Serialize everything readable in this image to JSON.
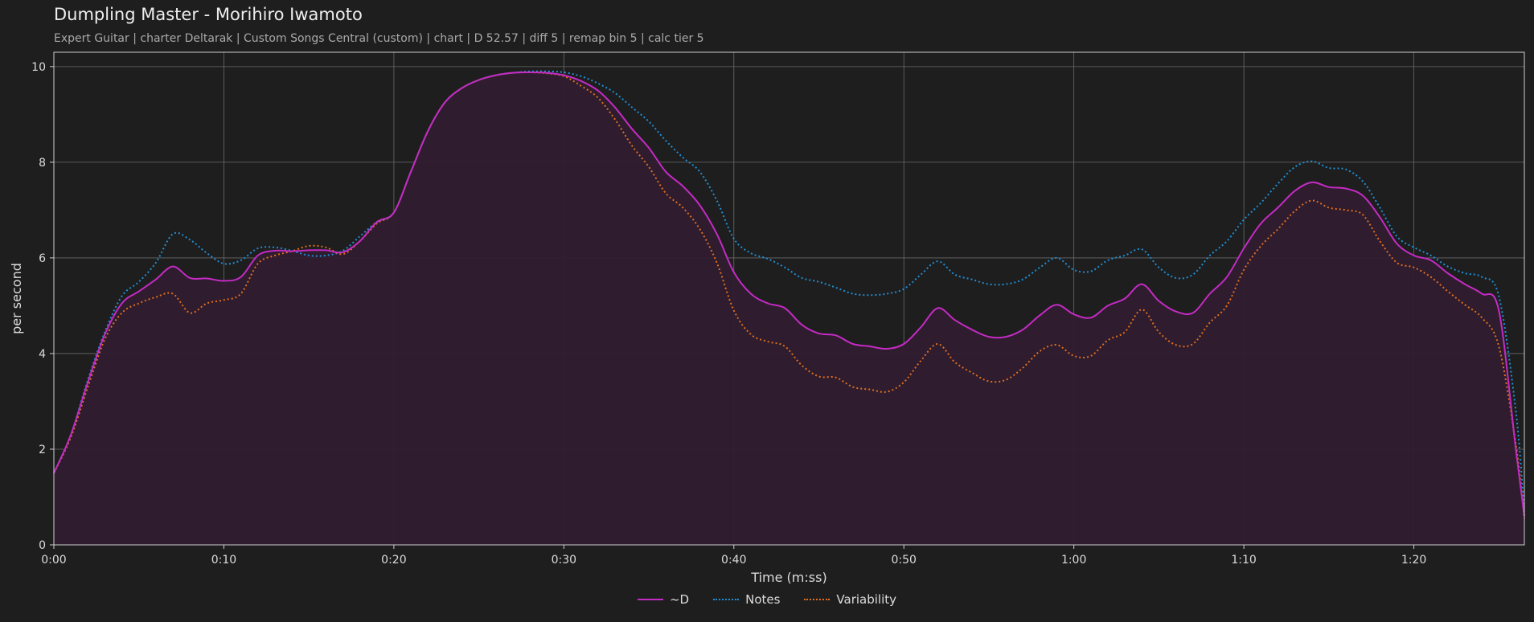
{
  "header": {
    "title": "Dumpling Master - Morihiro Iwamoto",
    "subtitle": "Expert Guitar  |  charter Deltarak  |  Custom Songs Central (custom)  |  chart  |  D 52.57  |  diff 5  |  remap bin 5  |  calc tier 5"
  },
  "colors": {
    "background": "#1e1e1e",
    "plot_border": "#cfcfcf",
    "grid": "#6a6a6a",
    "d_line": "#c42bc4",
    "d_fill": "#301c2f",
    "notes": "#1f8fd6",
    "variability": "#e0701e"
  },
  "chart_data": {
    "type": "line",
    "xlabel": "Time (m:ss)",
    "ylabel": "per second",
    "xlim": [
      0,
      86.5
    ],
    "ylim": [
      0,
      10.3
    ],
    "x_ticks": [
      {
        "value": 0,
        "label": "0:00"
      },
      {
        "value": 10,
        "label": "0:10"
      },
      {
        "value": 20,
        "label": "0:20"
      },
      {
        "value": 30,
        "label": "0:30"
      },
      {
        "value": 40,
        "label": "0:40"
      },
      {
        "value": 50,
        "label": "0:50"
      },
      {
        "value": 60,
        "label": "1:00"
      },
      {
        "value": 70,
        "label": "1:10"
      },
      {
        "value": 80,
        "label": "1:20"
      }
    ],
    "y_ticks": [
      0,
      2,
      4,
      6,
      8,
      10
    ],
    "grid": true,
    "legend_position": "bottom-center",
    "series": [
      {
        "name": "~D",
        "style": "solid",
        "filled": true,
        "color": "#c42bc4",
        "points": [
          [
            0,
            1.5
          ],
          [
            1,
            2.3
          ],
          [
            2,
            3.4
          ],
          [
            3,
            4.4
          ],
          [
            4,
            5.05
          ],
          [
            5,
            5.3
          ],
          [
            6,
            5.55
          ],
          [
            7,
            5.82
          ],
          [
            8,
            5.58
          ],
          [
            9,
            5.57
          ],
          [
            10,
            5.52
          ],
          [
            11,
            5.6
          ],
          [
            12,
            6.05
          ],
          [
            13,
            6.15
          ],
          [
            14,
            6.14
          ],
          [
            15,
            6.16
          ],
          [
            16,
            6.16
          ],
          [
            17,
            6.12
          ],
          [
            18,
            6.35
          ],
          [
            19,
            6.75
          ],
          [
            20,
            6.95
          ],
          [
            21,
            7.8
          ],
          [
            22,
            8.65
          ],
          [
            23,
            9.25
          ],
          [
            24,
            9.55
          ],
          [
            25,
            9.72
          ],
          [
            26,
            9.82
          ],
          [
            27,
            9.87
          ],
          [
            28,
            9.88
          ],
          [
            29,
            9.87
          ],
          [
            30,
            9.82
          ],
          [
            31,
            9.7
          ],
          [
            32,
            9.5
          ],
          [
            33,
            9.15
          ],
          [
            34,
            8.7
          ],
          [
            35,
            8.3
          ],
          [
            36,
            7.8
          ],
          [
            37,
            7.5
          ],
          [
            38,
            7.1
          ],
          [
            39,
            6.5
          ],
          [
            40,
            5.7
          ],
          [
            41,
            5.25
          ],
          [
            42,
            5.05
          ],
          [
            43,
            4.95
          ],
          [
            44,
            4.6
          ],
          [
            45,
            4.42
          ],
          [
            46,
            4.38
          ],
          [
            47,
            4.2
          ],
          [
            48,
            4.15
          ],
          [
            49,
            4.1
          ],
          [
            50,
            4.2
          ],
          [
            51,
            4.55
          ],
          [
            52,
            4.95
          ],
          [
            53,
            4.7
          ],
          [
            54,
            4.5
          ],
          [
            55,
            4.35
          ],
          [
            56,
            4.35
          ],
          [
            57,
            4.5
          ],
          [
            58,
            4.8
          ],
          [
            59,
            5.02
          ],
          [
            60,
            4.82
          ],
          [
            61,
            4.75
          ],
          [
            62,
            5.0
          ],
          [
            63,
            5.15
          ],
          [
            64,
            5.45
          ],
          [
            65,
            5.1
          ],
          [
            66,
            4.88
          ],
          [
            67,
            4.85
          ],
          [
            68,
            5.25
          ],
          [
            69,
            5.6
          ],
          [
            70,
            6.2
          ],
          [
            71,
            6.72
          ],
          [
            72,
            7.05
          ],
          [
            73,
            7.4
          ],
          [
            74,
            7.58
          ],
          [
            75,
            7.48
          ],
          [
            76,
            7.45
          ],
          [
            77,
            7.3
          ],
          [
            78,
            6.85
          ],
          [
            79,
            6.3
          ],
          [
            80,
            6.05
          ],
          [
            81,
            5.95
          ],
          [
            82,
            5.68
          ],
          [
            83,
            5.45
          ],
          [
            84,
            5.25
          ],
          [
            85,
            4.9
          ],
          [
            86,
            2.0
          ],
          [
            86.5,
            0.6
          ]
        ]
      },
      {
        "name": "Notes",
        "style": "dotted",
        "filled": false,
        "color": "#1f8fd6",
        "points": [
          [
            0,
            1.5
          ],
          [
            1,
            2.3
          ],
          [
            2,
            3.45
          ],
          [
            3,
            4.45
          ],
          [
            4,
            5.2
          ],
          [
            5,
            5.5
          ],
          [
            6,
            5.9
          ],
          [
            7,
            6.5
          ],
          [
            8,
            6.38
          ],
          [
            9,
            6.1
          ],
          [
            10,
            5.88
          ],
          [
            11,
            5.95
          ],
          [
            12,
            6.2
          ],
          [
            13,
            6.22
          ],
          [
            14,
            6.15
          ],
          [
            15,
            6.05
          ],
          [
            16,
            6.05
          ],
          [
            17,
            6.15
          ],
          [
            18,
            6.45
          ],
          [
            19,
            6.75
          ],
          [
            20,
            6.95
          ],
          [
            21,
            7.8
          ],
          [
            22,
            8.65
          ],
          [
            23,
            9.25
          ],
          [
            24,
            9.55
          ],
          [
            25,
            9.72
          ],
          [
            26,
            9.82
          ],
          [
            27,
            9.87
          ],
          [
            28,
            9.9
          ],
          [
            29,
            9.9
          ],
          [
            30,
            9.88
          ],
          [
            31,
            9.8
          ],
          [
            32,
            9.65
          ],
          [
            33,
            9.45
          ],
          [
            34,
            9.15
          ],
          [
            35,
            8.85
          ],
          [
            36,
            8.45
          ],
          [
            37,
            8.1
          ],
          [
            38,
            7.8
          ],
          [
            39,
            7.2
          ],
          [
            40,
            6.4
          ],
          [
            41,
            6.1
          ],
          [
            42,
            5.98
          ],
          [
            43,
            5.8
          ],
          [
            44,
            5.58
          ],
          [
            45,
            5.5
          ],
          [
            46,
            5.38
          ],
          [
            47,
            5.25
          ],
          [
            48,
            5.22
          ],
          [
            49,
            5.25
          ],
          [
            50,
            5.35
          ],
          [
            51,
            5.65
          ],
          [
            52,
            5.93
          ],
          [
            53,
            5.65
          ],
          [
            54,
            5.55
          ],
          [
            55,
            5.45
          ],
          [
            56,
            5.45
          ],
          [
            57,
            5.55
          ],
          [
            58,
            5.8
          ],
          [
            59,
            6.0
          ],
          [
            60,
            5.75
          ],
          [
            61,
            5.72
          ],
          [
            62,
            5.95
          ],
          [
            63,
            6.05
          ],
          [
            64,
            6.18
          ],
          [
            65,
            5.8
          ],
          [
            66,
            5.58
          ],
          [
            67,
            5.65
          ],
          [
            68,
            6.05
          ],
          [
            69,
            6.35
          ],
          [
            70,
            6.8
          ],
          [
            71,
            7.15
          ],
          [
            72,
            7.55
          ],
          [
            73,
            7.9
          ],
          [
            74,
            8.02
          ],
          [
            75,
            7.88
          ],
          [
            76,
            7.85
          ],
          [
            77,
            7.6
          ],
          [
            78,
            7.05
          ],
          [
            79,
            6.45
          ],
          [
            80,
            6.22
          ],
          [
            81,
            6.05
          ],
          [
            82,
            5.82
          ],
          [
            83,
            5.68
          ],
          [
            84,
            5.6
          ],
          [
            85,
            5.2
          ],
          [
            86,
            2.8
          ],
          [
            86.5,
            0.7
          ]
        ]
      },
      {
        "name": "Variability",
        "style": "dotted",
        "filled": false,
        "color": "#e0701e",
        "points": [
          [
            0,
            1.5
          ],
          [
            1,
            2.25
          ],
          [
            2,
            3.3
          ],
          [
            3,
            4.3
          ],
          [
            4,
            4.85
          ],
          [
            5,
            5.05
          ],
          [
            6,
            5.18
          ],
          [
            7,
            5.25
          ],
          [
            8,
            4.85
          ],
          [
            9,
            5.05
          ],
          [
            10,
            5.12
          ],
          [
            11,
            5.25
          ],
          [
            12,
            5.88
          ],
          [
            13,
            6.05
          ],
          [
            14,
            6.14
          ],
          [
            15,
            6.25
          ],
          [
            16,
            6.22
          ],
          [
            17,
            6.08
          ],
          [
            18,
            6.35
          ],
          [
            19,
            6.72
          ],
          [
            20,
            6.95
          ],
          [
            21,
            7.8
          ],
          [
            22,
            8.65
          ],
          [
            23,
            9.25
          ],
          [
            24,
            9.55
          ],
          [
            25,
            9.72
          ],
          [
            26,
            9.82
          ],
          [
            27,
            9.87
          ],
          [
            28,
            9.88
          ],
          [
            29,
            9.86
          ],
          [
            30,
            9.8
          ],
          [
            31,
            9.6
          ],
          [
            32,
            9.35
          ],
          [
            33,
            8.9
          ],
          [
            34,
            8.35
          ],
          [
            35,
            7.9
          ],
          [
            36,
            7.35
          ],
          [
            37,
            7.05
          ],
          [
            38,
            6.6
          ],
          [
            39,
            5.9
          ],
          [
            40,
            4.9
          ],
          [
            41,
            4.4
          ],
          [
            42,
            4.25
          ],
          [
            43,
            4.15
          ],
          [
            44,
            3.75
          ],
          [
            45,
            3.52
          ],
          [
            46,
            3.5
          ],
          [
            47,
            3.3
          ],
          [
            48,
            3.25
          ],
          [
            49,
            3.2
          ],
          [
            50,
            3.4
          ],
          [
            51,
            3.85
          ],
          [
            52,
            4.2
          ],
          [
            53,
            3.82
          ],
          [
            54,
            3.6
          ],
          [
            55,
            3.42
          ],
          [
            56,
            3.45
          ],
          [
            57,
            3.7
          ],
          [
            58,
            4.05
          ],
          [
            59,
            4.18
          ],
          [
            60,
            3.95
          ],
          [
            61,
            3.95
          ],
          [
            62,
            4.28
          ],
          [
            63,
            4.45
          ],
          [
            64,
            4.92
          ],
          [
            65,
            4.45
          ],
          [
            66,
            4.18
          ],
          [
            67,
            4.2
          ],
          [
            68,
            4.65
          ],
          [
            69,
            5.0
          ],
          [
            70,
            5.75
          ],
          [
            71,
            6.25
          ],
          [
            72,
            6.6
          ],
          [
            73,
            6.98
          ],
          [
            74,
            7.2
          ],
          [
            75,
            7.05
          ],
          [
            76,
            7.0
          ],
          [
            77,
            6.9
          ],
          [
            78,
            6.35
          ],
          [
            79,
            5.9
          ],
          [
            80,
            5.8
          ],
          [
            81,
            5.6
          ],
          [
            82,
            5.3
          ],
          [
            83,
            5.02
          ],
          [
            84,
            4.75
          ],
          [
            85,
            4.15
          ],
          [
            86,
            2.1
          ],
          [
            86.5,
            0.55
          ]
        ]
      }
    ]
  }
}
